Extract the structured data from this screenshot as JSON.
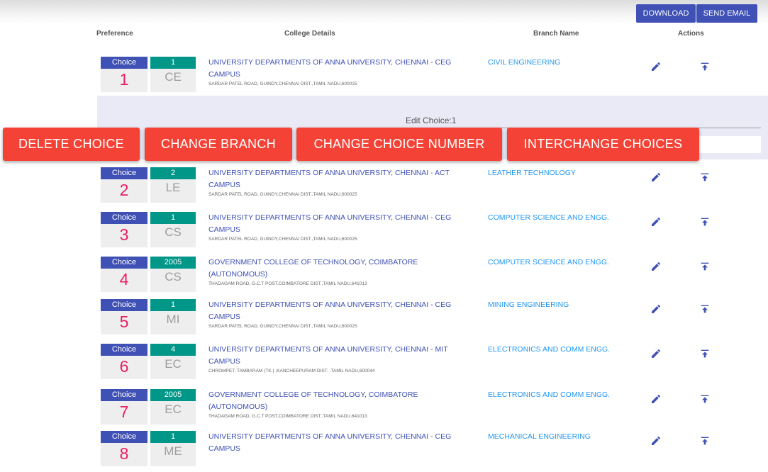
{
  "toolbar": {
    "download": "DOWNLOAD",
    "send_email": "SEND EMAIL"
  },
  "headers": {
    "preference": "Preference",
    "college": "College Details",
    "branch": "Branch Name",
    "actions": "Actions"
  },
  "edit_panel": {
    "title": "Edit Choice:1"
  },
  "overlay_buttons": {
    "delete": "DELETE CHOICE",
    "change_branch": "CHANGE BRANCH",
    "change_number": "CHANGE CHOICE NUMBER",
    "interchange": "INTERCHANGE CHOICES"
  },
  "choice_label": "Choice",
  "icons": {
    "edit": "pencil-icon",
    "move_top": "move-to-top-icon"
  },
  "colors": {
    "primary": "#3f51b5",
    "teal": "#009688",
    "accent": "#e91e63",
    "danger": "#f44336",
    "link": "#2196f3"
  },
  "choices": [
    {
      "choice": "1",
      "college_code": "1",
      "branch_code": "CE",
      "college_line1": "UNIVERSITY DEPARTMENTS OF ANNA UNIVERSITY, CHENNAI - CEG",
      "college_line2": "CAMPUS",
      "address": "SARDAR PATEL ROAD, GUINDY,CHENNAI DIST.,TAMIL NADU,600025",
      "branch": "CIVIL ENGINEERING"
    },
    {
      "choice": "2",
      "college_code": "2",
      "branch_code": "LE",
      "college_line1": "UNIVERSITY DEPARTMENTS OF ANNA UNIVERSITY, CHENNAI - ACT",
      "college_line2": "CAMPUS",
      "address": "SARDAR PATEL ROAD, GUINDY,CHENNAI DIST.,TAMIL NADU,600025",
      "branch": "LEATHER TECHNOLOGY"
    },
    {
      "choice": "3",
      "college_code": "1",
      "branch_code": "CS",
      "college_line1": "UNIVERSITY DEPARTMENTS OF ANNA UNIVERSITY, CHENNAI - CEG",
      "college_line2": "CAMPUS",
      "address": "SARDAR PATEL ROAD, GUINDY,CHENNAI DIST.,TAMIL NADU,600025",
      "branch": "COMPUTER SCIENCE AND ENGG."
    },
    {
      "choice": "4",
      "college_code": "2005",
      "branch_code": "CS",
      "college_line1": "GOVERNMENT COLLEGE OF TECHNOLOGY, COIMBATORE (AUTONOMOUS)",
      "college_line2": "",
      "address": "THADAGAM ROAD, G.C.T POST,COIMBATORE DIST.,TAMIL NADU,641013",
      "branch": "COMPUTER SCIENCE AND ENGG."
    },
    {
      "choice": "5",
      "college_code": "1",
      "branch_code": "MI",
      "college_line1": "UNIVERSITY DEPARTMENTS OF ANNA UNIVERSITY, CHENNAI - CEG",
      "college_line2": "CAMPUS",
      "address": "SARDAR PATEL ROAD, GUINDY,CHENNAI DIST.,TAMIL NADU,600025",
      "branch": "MINING ENGINEERING"
    },
    {
      "choice": "6",
      "college_code": "4",
      "branch_code": "EC",
      "college_line1": "UNIVERSITY DEPARTMENTS OF ANNA UNIVERSITY, CHENNAI - MIT",
      "college_line2": "CAMPUS",
      "address": "CHROMPET, TAMBARAM (TK.) ,KANCHEEPURAM DIST. ,TAMIL NADU,600044",
      "branch": "ELECTRONICS AND COMM ENGG."
    },
    {
      "choice": "7",
      "college_code": "2005",
      "branch_code": "EC",
      "college_line1": "GOVERNMENT COLLEGE OF TECHNOLOGY, COIMBATORE (AUTONOMOUS)",
      "college_line2": "",
      "address": "THADAGAM ROAD, G.C.T POST,COIMBATORE DIST.,TAMIL NADU,641013",
      "branch": "ELECTRONICS AND COMM ENGG."
    },
    {
      "choice": "8",
      "college_code": "1",
      "branch_code": "ME",
      "college_line1": "UNIVERSITY DEPARTMENTS OF ANNA UNIVERSITY, CHENNAI - CEG",
      "college_line2": "CAMPUS",
      "address": "",
      "branch": "MECHANICAL ENGINEERING"
    }
  ]
}
